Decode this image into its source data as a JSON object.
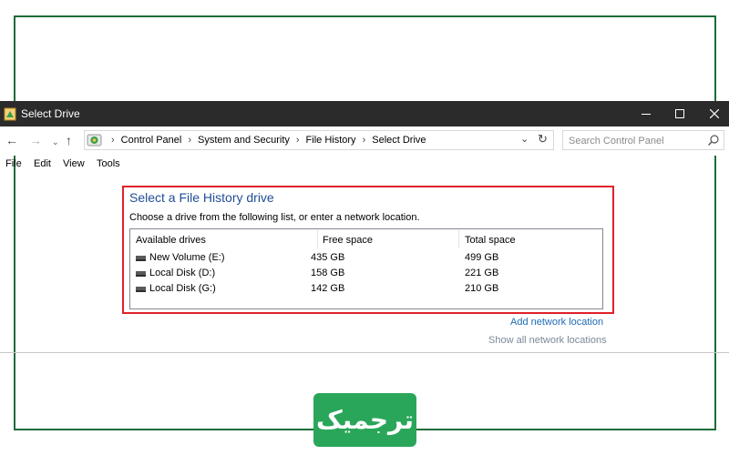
{
  "window": {
    "title": "Select Drive",
    "controls": {
      "minimize": "minimize",
      "maximize": "maximize",
      "close": "close"
    }
  },
  "address": {
    "breadcrumb": [
      "Control Panel",
      "System and Security",
      "File History",
      "Select Drive"
    ],
    "search_placeholder": "Search Control Panel"
  },
  "menu": [
    "File",
    "Edit",
    "View",
    "Tools"
  ],
  "main": {
    "title": "Select a File History drive",
    "instructions": "Choose a drive from the following list, or enter a network location.",
    "table": {
      "headers": [
        "Available drives",
        "Free space",
        "Total space"
      ],
      "rows": [
        {
          "name": "New Volume (E:)",
          "free": "435 GB",
          "total": "499 GB"
        },
        {
          "name": "Local Disk (D:)",
          "free": "158 GB",
          "total": "221 GB"
        },
        {
          "name": "Local Disk (G:)",
          "free": "142 GB",
          "total": "210 GB"
        }
      ]
    },
    "links": {
      "add": "Add network location",
      "show": "Show all network locations"
    }
  },
  "watermark": {
    "text": "ترجمیک"
  },
  "colors": {
    "titlebar": "#2b2b2b",
    "frame": "#1f6b3a",
    "highlight": "#e0202a",
    "title_text": "#1f4e96",
    "link": "#1f6bb5",
    "logo": "#2aa65a"
  },
  "icons": {
    "app": "control-panel-icon",
    "back": "arrow-left-icon",
    "forward": "arrow-right-icon",
    "recent": "chevron-down-icon",
    "up": "arrow-up-icon",
    "dropdown": "chevron-down-icon",
    "refresh": "refresh-icon",
    "search": "search-icon",
    "drive": "drive-icon"
  }
}
